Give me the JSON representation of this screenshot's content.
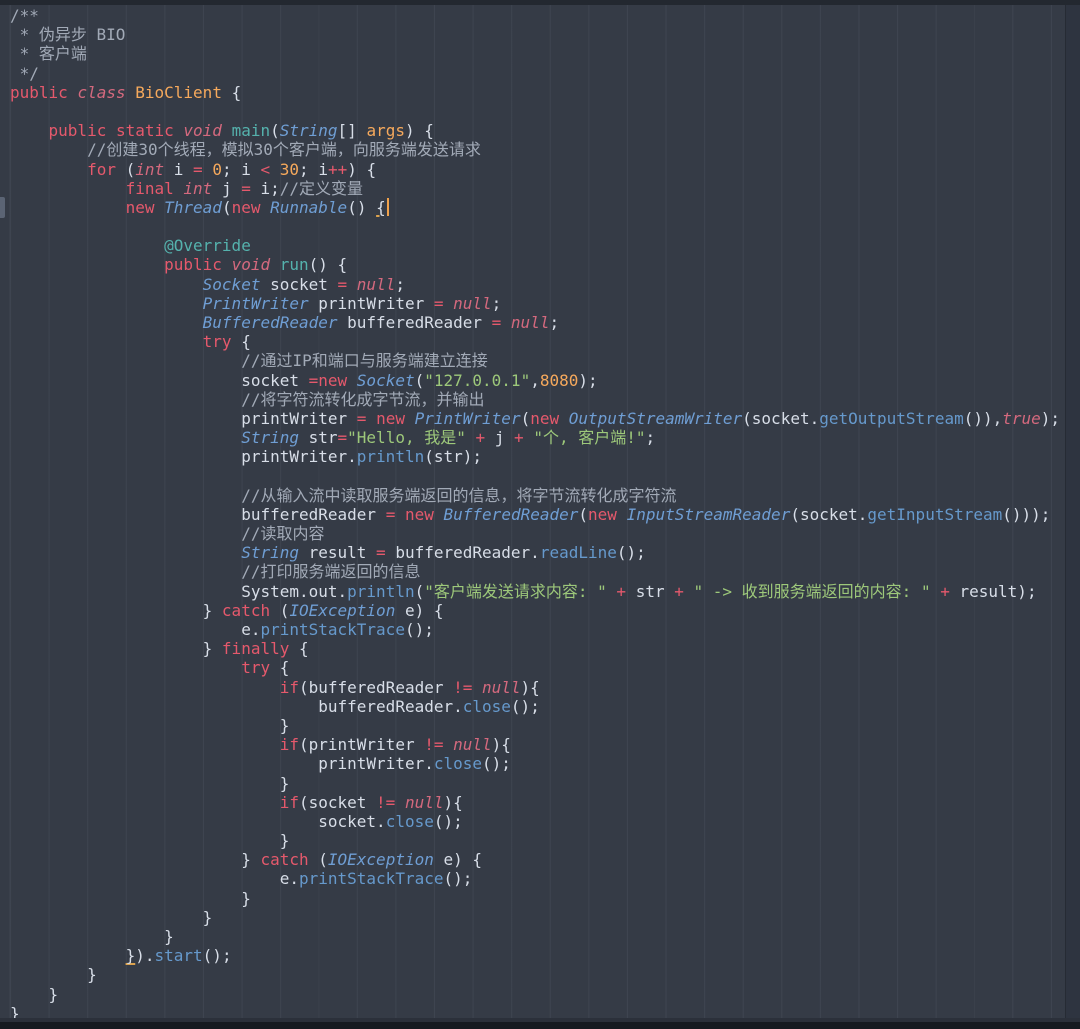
{
  "editor": {
    "language": "java",
    "file_class_name": "BioClient",
    "cursor_line": 11,
    "palette": {
      "background": "#353b46",
      "default_text": "#d8dee8",
      "comment": "#a2aab7",
      "keyword": "#e5596c",
      "keyword_italic": "#d4697e",
      "type_italic": "#6f9ed4",
      "method_call": "#6699cc",
      "method_def_teal": "#55b2ad",
      "number_const": "#f6a95c",
      "string": "#9dc87a",
      "cursor": "#f0a24c",
      "bracket_match_underline": "#dba24e",
      "indent_guide": "rgba(220,230,255,0.055)",
      "scrollbar_track": "#2e3440",
      "top_edge": "#232830",
      "bottom_edge": "#161a20",
      "bottom_edge_upper": "#2b303a",
      "gutter_marker": "#5b6474"
    },
    "lines": [
      {
        "tokens": [
          [
            "com",
            "/**"
          ]
        ]
      },
      {
        "tokens": [
          [
            "com",
            " * 伪异步 BIO"
          ]
        ]
      },
      {
        "tokens": [
          [
            "com",
            " * 客户端"
          ]
        ]
      },
      {
        "tokens": [
          [
            "com",
            " */"
          ]
        ]
      },
      {
        "tokens": [
          [
            "kw",
            "public"
          ],
          [
            "txt",
            " "
          ],
          [
            "it",
            "class"
          ],
          [
            "txt",
            " "
          ],
          [
            "cls",
            "BioClient"
          ],
          [
            "txt",
            " {"
          ]
        ]
      },
      {
        "tokens": []
      },
      {
        "tokens": [
          [
            "txt",
            "    "
          ],
          [
            "kw",
            "public"
          ],
          [
            "txt",
            " "
          ],
          [
            "kw",
            "static"
          ],
          [
            "txt",
            " "
          ],
          [
            "it",
            "void"
          ],
          [
            "txt",
            " "
          ],
          [
            "fn",
            "main"
          ],
          [
            "txt",
            "("
          ],
          [
            "type",
            "String"
          ],
          [
            "txt",
            "[] "
          ],
          [
            "cls",
            "args"
          ],
          [
            "txt",
            ") {"
          ]
        ]
      },
      {
        "tokens": [
          [
            "txt",
            "        "
          ],
          [
            "com",
            "//创建30个线程，模拟30个客户端，向服务端发送请求"
          ]
        ]
      },
      {
        "tokens": [
          [
            "txt",
            "        "
          ],
          [
            "kw",
            "for"
          ],
          [
            "txt",
            " ("
          ],
          [
            "it",
            "int"
          ],
          [
            "txt",
            " i "
          ],
          [
            "kw",
            "="
          ],
          [
            "txt",
            " "
          ],
          [
            "num",
            "0"
          ],
          [
            "txt",
            "; i "
          ],
          [
            "kw",
            "<"
          ],
          [
            "txt",
            " "
          ],
          [
            "num",
            "30"
          ],
          [
            "txt",
            "; i"
          ],
          [
            "kw",
            "++"
          ],
          [
            "txt",
            ") {"
          ]
        ]
      },
      {
        "tokens": [
          [
            "txt",
            "            "
          ],
          [
            "kw",
            "final"
          ],
          [
            "txt",
            " "
          ],
          [
            "it",
            "int"
          ],
          [
            "txt",
            " j "
          ],
          [
            "kw",
            "="
          ],
          [
            "txt",
            " i;"
          ],
          [
            "com",
            "//定义变量"
          ]
        ]
      },
      {
        "tokens": [
          [
            "txt",
            "            "
          ],
          [
            "kw",
            "new"
          ],
          [
            "txt",
            " "
          ],
          [
            "type",
            "Thread"
          ],
          [
            "txt",
            "("
          ],
          [
            "kw",
            "new"
          ],
          [
            "txt",
            " "
          ],
          [
            "type",
            "Runnable"
          ],
          [
            "txt",
            "() "
          ],
          [
            "brk",
            "{"
          ],
          [
            "cursor",
            ""
          ]
        ]
      },
      {
        "tokens": []
      },
      {
        "tokens": [
          [
            "txt",
            "                "
          ],
          [
            "fn",
            "@Override"
          ]
        ]
      },
      {
        "tokens": [
          [
            "txt",
            "                "
          ],
          [
            "kw",
            "public"
          ],
          [
            "txt",
            " "
          ],
          [
            "it",
            "void"
          ],
          [
            "txt",
            " "
          ],
          [
            "fn",
            "run"
          ],
          [
            "txt",
            "() {"
          ]
        ]
      },
      {
        "tokens": [
          [
            "txt",
            "                    "
          ],
          [
            "type",
            "Socket"
          ],
          [
            "txt",
            " socket "
          ],
          [
            "kw",
            "="
          ],
          [
            "txt",
            " "
          ],
          [
            "it",
            "null"
          ],
          [
            "txt",
            ";"
          ]
        ]
      },
      {
        "tokens": [
          [
            "txt",
            "                    "
          ],
          [
            "type",
            "PrintWriter"
          ],
          [
            "txt",
            " printWriter "
          ],
          [
            "kw",
            "="
          ],
          [
            "txt",
            " "
          ],
          [
            "it",
            "null"
          ],
          [
            "txt",
            ";"
          ]
        ]
      },
      {
        "tokens": [
          [
            "txt",
            "                    "
          ],
          [
            "type",
            "BufferedReader"
          ],
          [
            "txt",
            " bufferedReader "
          ],
          [
            "kw",
            "="
          ],
          [
            "txt",
            " "
          ],
          [
            "it",
            "null"
          ],
          [
            "txt",
            ";"
          ]
        ]
      },
      {
        "tokens": [
          [
            "txt",
            "                    "
          ],
          [
            "kw",
            "try"
          ],
          [
            "txt",
            " {"
          ]
        ]
      },
      {
        "tokens": [
          [
            "txt",
            "                        "
          ],
          [
            "com",
            "//通过IP和端口与服务端建立连接"
          ]
        ]
      },
      {
        "tokens": [
          [
            "txt",
            "                        socket "
          ],
          [
            "kw",
            "=new"
          ],
          [
            "txt",
            " "
          ],
          [
            "type",
            "Socket"
          ],
          [
            "txt",
            "("
          ],
          [
            "str",
            "\"127.0.0.1\""
          ],
          [
            "txt",
            ","
          ],
          [
            "num",
            "8080"
          ],
          [
            "txt",
            ");"
          ]
        ]
      },
      {
        "tokens": [
          [
            "txt",
            "                        "
          ],
          [
            "com",
            "//将字符流转化成字节流，并输出"
          ]
        ]
      },
      {
        "tokens": [
          [
            "txt",
            "                        printWriter "
          ],
          [
            "kw",
            "="
          ],
          [
            "txt",
            " "
          ],
          [
            "kw",
            "new"
          ],
          [
            "txt",
            " "
          ],
          [
            "type",
            "PrintWriter"
          ],
          [
            "txt",
            "("
          ],
          [
            "kw",
            "new"
          ],
          [
            "txt",
            " "
          ],
          [
            "type",
            "OutputStreamWriter"
          ],
          [
            "txt",
            "(socket."
          ],
          [
            "call",
            "getOutputStream"
          ],
          [
            "txt",
            "()),"
          ],
          [
            "it",
            "true"
          ],
          [
            "txt",
            ");"
          ]
        ]
      },
      {
        "tokens": [
          [
            "txt",
            "                        "
          ],
          [
            "type",
            "String"
          ],
          [
            "txt",
            " str"
          ],
          [
            "kw",
            "="
          ],
          [
            "str",
            "\"Hello, 我是\""
          ],
          [
            "txt",
            " "
          ],
          [
            "kw",
            "+"
          ],
          [
            "txt",
            " j "
          ],
          [
            "kw",
            "+"
          ],
          [
            "txt",
            " "
          ],
          [
            "str",
            "\"个, 客户端!\""
          ],
          [
            "txt",
            ";"
          ]
        ]
      },
      {
        "tokens": [
          [
            "txt",
            "                        printWriter."
          ],
          [
            "call",
            "println"
          ],
          [
            "txt",
            "(str);"
          ]
        ]
      },
      {
        "tokens": []
      },
      {
        "tokens": [
          [
            "txt",
            "                        "
          ],
          [
            "com",
            "//从输入流中读取服务端返回的信息，将字节流转化成字符流"
          ]
        ]
      },
      {
        "tokens": [
          [
            "txt",
            "                        bufferedReader "
          ],
          [
            "kw",
            "="
          ],
          [
            "txt",
            " "
          ],
          [
            "kw",
            "new"
          ],
          [
            "txt",
            " "
          ],
          [
            "type",
            "BufferedReader"
          ],
          [
            "txt",
            "("
          ],
          [
            "kw",
            "new"
          ],
          [
            "txt",
            " "
          ],
          [
            "type",
            "InputStreamReader"
          ],
          [
            "txt",
            "(socket."
          ],
          [
            "call",
            "getInputStream"
          ],
          [
            "txt",
            "()));"
          ]
        ]
      },
      {
        "tokens": [
          [
            "txt",
            "                        "
          ],
          [
            "com",
            "//读取内容"
          ]
        ]
      },
      {
        "tokens": [
          [
            "txt",
            "                        "
          ],
          [
            "type",
            "String"
          ],
          [
            "txt",
            " result "
          ],
          [
            "kw",
            "="
          ],
          [
            "txt",
            " bufferedReader."
          ],
          [
            "call",
            "readLine"
          ],
          [
            "txt",
            "();"
          ]
        ]
      },
      {
        "tokens": [
          [
            "txt",
            "                        "
          ],
          [
            "com",
            "//打印服务端返回的信息"
          ]
        ]
      },
      {
        "tokens": [
          [
            "txt",
            "                        System.out."
          ],
          [
            "call",
            "println"
          ],
          [
            "txt",
            "("
          ],
          [
            "str",
            "\"客户端发送请求内容: \""
          ],
          [
            "txt",
            " "
          ],
          [
            "kw",
            "+"
          ],
          [
            "txt",
            " str "
          ],
          [
            "kw",
            "+"
          ],
          [
            "txt",
            " "
          ],
          [
            "str",
            "\" -> 收到服务端返回的内容: \""
          ],
          [
            "txt",
            " "
          ],
          [
            "kw",
            "+"
          ],
          [
            "txt",
            " result);"
          ]
        ]
      },
      {
        "tokens": [
          [
            "txt",
            "                    } "
          ],
          [
            "kw",
            "catch"
          ],
          [
            "txt",
            " ("
          ],
          [
            "type",
            "IOException"
          ],
          [
            "txt",
            " e) {"
          ]
        ]
      },
      {
        "tokens": [
          [
            "txt",
            "                        e."
          ],
          [
            "call",
            "printStackTrace"
          ],
          [
            "txt",
            "();"
          ]
        ]
      },
      {
        "tokens": [
          [
            "txt",
            "                    } "
          ],
          [
            "kw",
            "finally"
          ],
          [
            "txt",
            " {"
          ]
        ]
      },
      {
        "tokens": [
          [
            "txt",
            "                        "
          ],
          [
            "kw",
            "try"
          ],
          [
            "txt",
            " {"
          ]
        ]
      },
      {
        "tokens": [
          [
            "txt",
            "                            "
          ],
          [
            "kw",
            "if"
          ],
          [
            "txt",
            "(bufferedReader "
          ],
          [
            "kw",
            "!="
          ],
          [
            "txt",
            " "
          ],
          [
            "it",
            "null"
          ],
          [
            "txt",
            "){"
          ]
        ]
      },
      {
        "tokens": [
          [
            "txt",
            "                                bufferedReader."
          ],
          [
            "call",
            "close"
          ],
          [
            "txt",
            "();"
          ]
        ]
      },
      {
        "tokens": [
          [
            "txt",
            "                            }"
          ]
        ]
      },
      {
        "tokens": [
          [
            "txt",
            "                            "
          ],
          [
            "kw",
            "if"
          ],
          [
            "txt",
            "(printWriter "
          ],
          [
            "kw",
            "!="
          ],
          [
            "txt",
            " "
          ],
          [
            "it",
            "null"
          ],
          [
            "txt",
            "){"
          ]
        ]
      },
      {
        "tokens": [
          [
            "txt",
            "                                printWriter."
          ],
          [
            "call",
            "close"
          ],
          [
            "txt",
            "();"
          ]
        ]
      },
      {
        "tokens": [
          [
            "txt",
            "                            }"
          ]
        ]
      },
      {
        "tokens": [
          [
            "txt",
            "                            "
          ],
          [
            "kw",
            "if"
          ],
          [
            "txt",
            "(socket "
          ],
          [
            "kw",
            "!="
          ],
          [
            "txt",
            " "
          ],
          [
            "it",
            "null"
          ],
          [
            "txt",
            "){"
          ]
        ]
      },
      {
        "tokens": [
          [
            "txt",
            "                                socket."
          ],
          [
            "call",
            "close"
          ],
          [
            "txt",
            "();"
          ]
        ]
      },
      {
        "tokens": [
          [
            "txt",
            "                            }"
          ]
        ]
      },
      {
        "tokens": [
          [
            "txt",
            "                        } "
          ],
          [
            "kw",
            "catch"
          ],
          [
            "txt",
            " ("
          ],
          [
            "type",
            "IOException"
          ],
          [
            "txt",
            " e) {"
          ]
        ]
      },
      {
        "tokens": [
          [
            "txt",
            "                            e."
          ],
          [
            "call",
            "printStackTrace"
          ],
          [
            "txt",
            "();"
          ]
        ]
      },
      {
        "tokens": [
          [
            "txt",
            "                        }"
          ]
        ]
      },
      {
        "tokens": [
          [
            "txt",
            "                    }"
          ]
        ]
      },
      {
        "tokens": [
          [
            "txt",
            "                }"
          ]
        ]
      },
      {
        "tokens": [
          [
            "txt",
            "            "
          ],
          [
            "brk",
            "}"
          ],
          [
            "txt",
            ")."
          ],
          [
            "call",
            "start"
          ],
          [
            "txt",
            "();"
          ]
        ]
      },
      {
        "tokens": [
          [
            "txt",
            "        }"
          ]
        ]
      },
      {
        "tokens": [
          [
            "txt",
            "    }"
          ]
        ]
      },
      {
        "tokens": [
          [
            "txt",
            "}"
          ]
        ]
      }
    ]
  }
}
